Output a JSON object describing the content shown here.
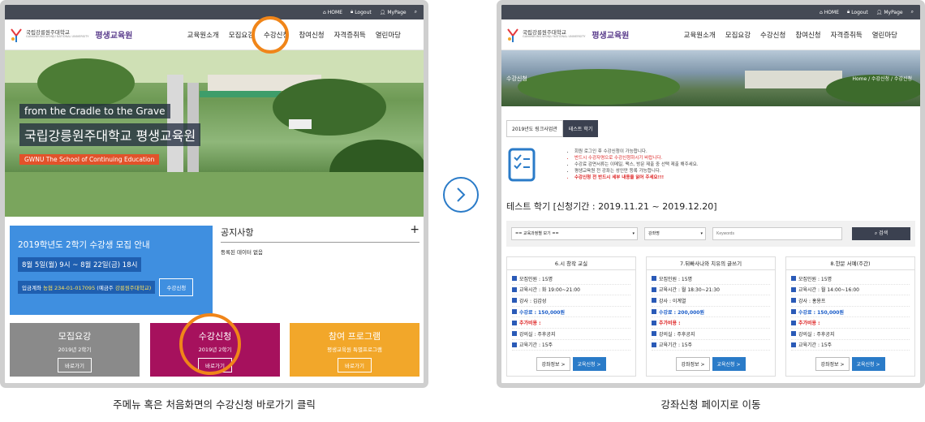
{
  "left": {
    "topbar": {
      "home": "HOME",
      "logout": "Logout",
      "mypage": "MyPage"
    },
    "logo": {
      "univ": "국립강릉원주대학교",
      "univ_en": "GANGNEUNG-WONJU NATIONAL UNIVERSITY",
      "sub": "평생교육원"
    },
    "nav": [
      "교육원소개",
      "모집요강",
      "수강신청",
      "참여신청",
      "자격증취득",
      "열린마당"
    ],
    "hero": {
      "line1": "from the Cradle to the Grave",
      "line2": "국립강릉원주대학교 평생교육원",
      "line3": "GWNU The School of Continuing Education"
    },
    "recruit": {
      "title": "2019학년도 2학기 수강생 모집 안내",
      "period": "8월 5일(월) 9시 ~ 8월 22일(금) 18시",
      "account_label": "입금계좌",
      "account": "농협 234-01-017095",
      "account_holder_label": "(예금주",
      "account_holder": "강릉원주대학교)",
      "button": "수강신청"
    },
    "notice": {
      "title": "공지사항",
      "empty": "등록된 데이터 없음"
    },
    "tiles": [
      {
        "title": "모집요강",
        "sub": "2019년 2학기",
        "button": "바로가기"
      },
      {
        "title": "수강신청",
        "sub": "2019년 2학기",
        "button": "바로가기"
      },
      {
        "title": "참여 프로그램",
        "sub": "평생교육원 특별프로그램",
        "button": "바로가기"
      }
    ],
    "caption": "주메뉴 혹은 처음화면의 수강신청 바로가기 클릭"
  },
  "right": {
    "topbar": {
      "home": "HOME",
      "logout": "Logout",
      "mypage": "MyPage"
    },
    "logo": {
      "univ": "국립강릉원주대학교",
      "univ_en": "GANGNEUNG-WONJU NATIONAL UNIVERSITY",
      "sub": "평생교육원"
    },
    "nav": [
      "교육원소개",
      "모집요강",
      "수강신청",
      "참여신청",
      "자격증취득",
      "열린마당"
    ],
    "banner": {
      "title": "수강신청",
      "breadcrumb": "Home / 수강신청 / 수강신청"
    },
    "subtabs": [
      "2019년도 링크사업관",
      "테스트 학기"
    ],
    "info": [
      "회원 로그인 후 수강신청이 가능합니다.",
      "반드시 수강자명으로 수강신청하시기 바랍니다.",
      "수강료 감면서류는 이메일, 팩스, 방문 제출 중 선택 제출 해주세요.",
      "평생교육원 전 강좌는 성인만 등록 가능합니다.",
      "수강신청 전 반드시 세부 내용을 읽어 주세요!!!"
    ],
    "term_title": "테스트 학기 [신청기간 : 2019.11.21 ~ 2019.12.20]",
    "search": {
      "select1": "== 교육과정별 보기 ==",
      "select2": "강좌명",
      "placeholder": "Keywords",
      "button": "검색"
    },
    "cards": [
      {
        "title": "6.시 창작 교실",
        "rows": [
          "모집인원 : 15명",
          "교육시간 : 화 19:00~21:00",
          "강사 : 김갑성",
          "수강료 : 150,000원",
          "추가비용 :",
          "강의실 : 주후공지",
          "교육기간 : 15주"
        ]
      },
      {
        "title": "7.뒤빠사나와 치유의 글쓰기",
        "rows": [
          "모집인원 : 15명",
          "교육시간 : 월 18:30~21:30",
          "강사 : 이계열",
          "수강료 : 200,000원",
          "추가비용 :",
          "강의실 : 주후공지",
          "교육기간 : 15주"
        ]
      },
      {
        "title": "8.한문 서예(주간)",
        "rows": [
          "모집인원 : 15명",
          "교육시간 : 월 14:00~16:00",
          "강사 : 홍용프",
          "수강료 : 150,000원",
          "추가비용 :",
          "강의실 : 주후공지",
          "교육기간 : 15주"
        ]
      }
    ],
    "card_buttons": {
      "info": "강좌정보 >",
      "apply": "교육신청 >"
    },
    "caption": "강좌신청 페이지로 이동"
  },
  "colors": {
    "accent_orange": "#f08519",
    "blue": "#3f8fe0",
    "tile_gray": "#8a8a8a",
    "tile_magenta": "#a6115d",
    "tile_orange": "#f2a72a"
  }
}
